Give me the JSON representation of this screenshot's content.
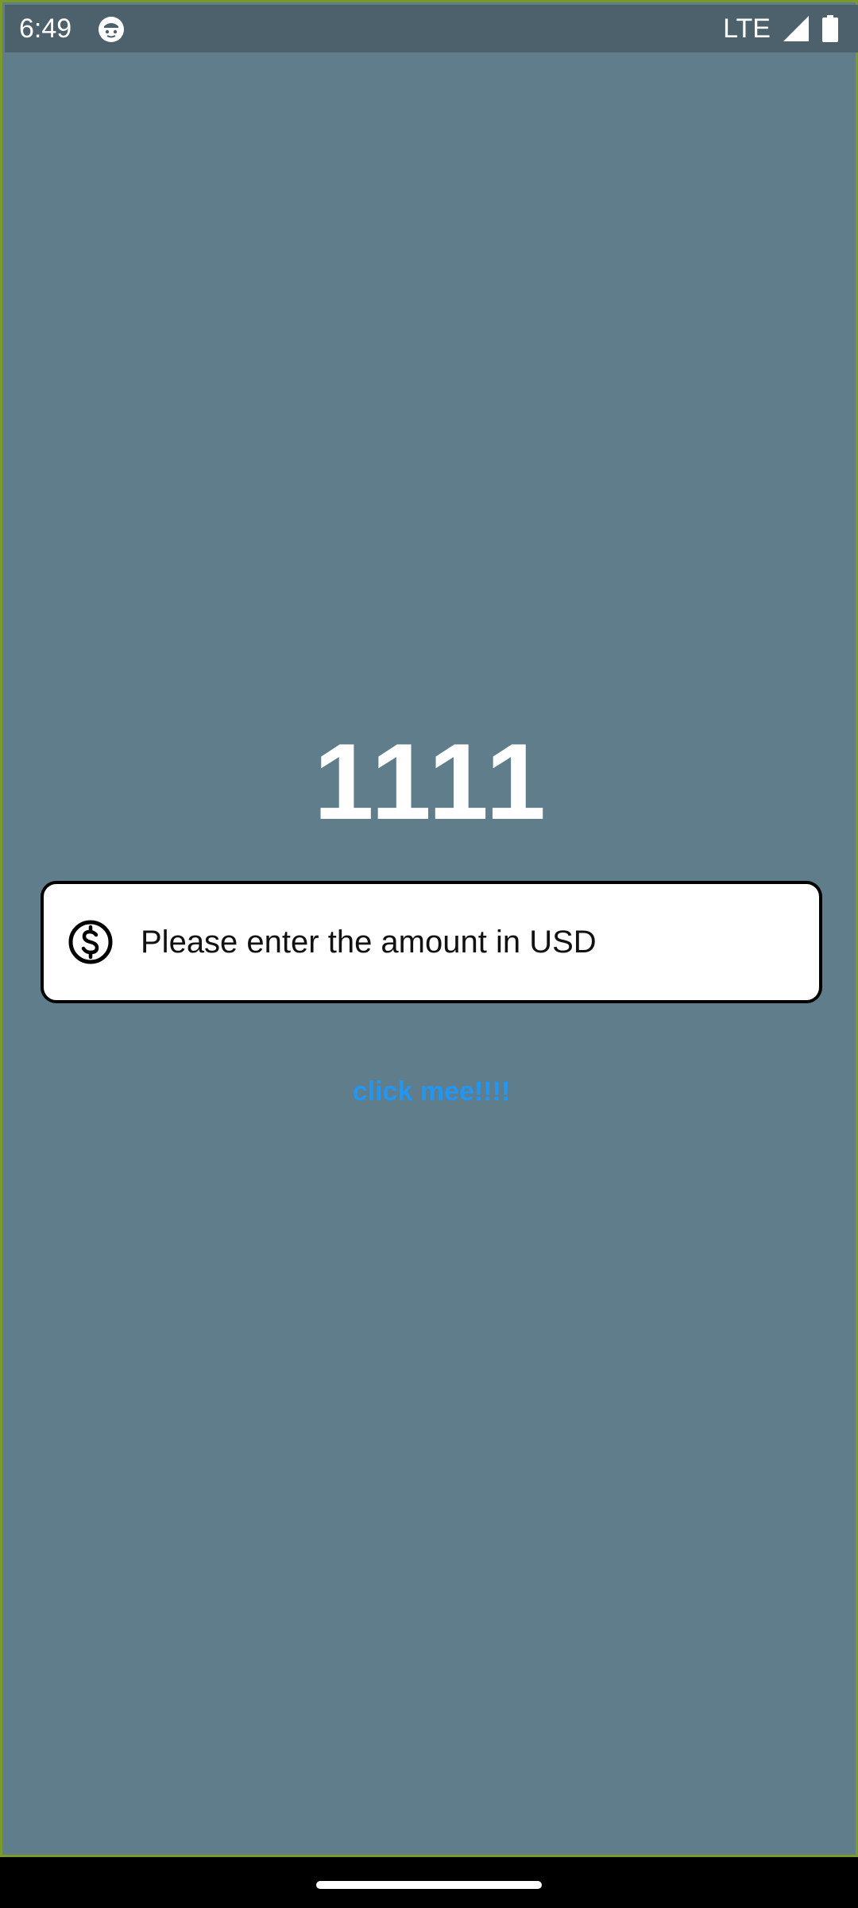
{
  "status_bar": {
    "time": "6:49",
    "network": "LTE"
  },
  "main": {
    "amount": "1111",
    "input": {
      "value": "",
      "placeholder": "Please enter the amount in USD",
      "icon": "dollar-circle-icon"
    },
    "button_label": "click mee!!!!"
  },
  "colors": {
    "background": "#607d8b",
    "status_bar": "#4d616c",
    "button_text": "#2196f3",
    "frame_border": "#7a9a2c"
  }
}
